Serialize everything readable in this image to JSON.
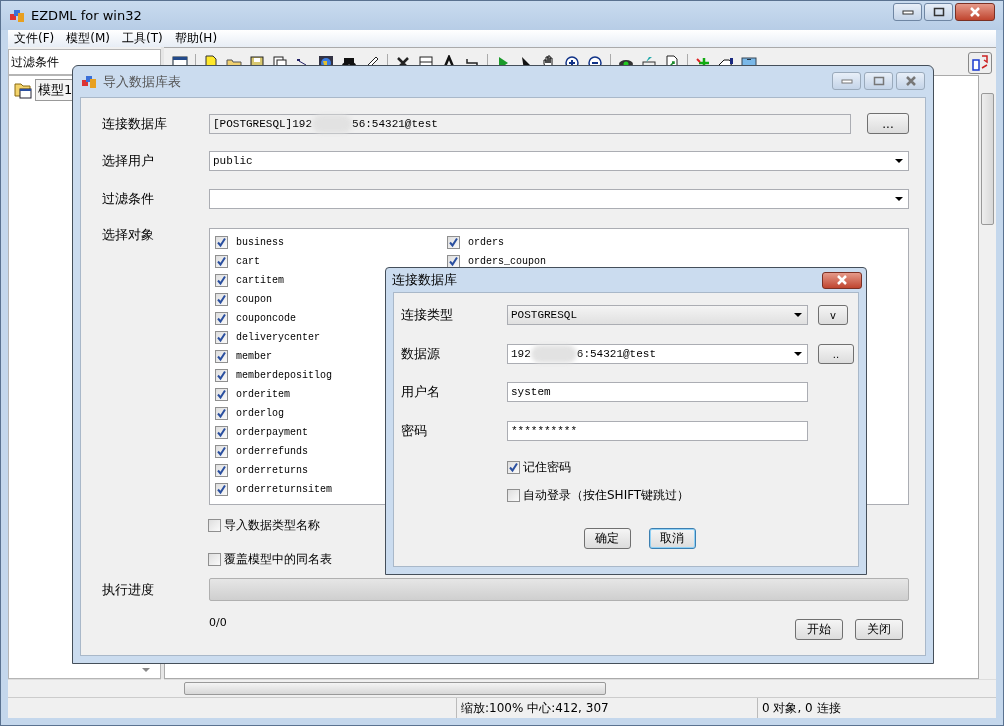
{
  "main_window": {
    "title": "EZDML for win32"
  },
  "menu": [
    {
      "label": "文件(F)"
    },
    {
      "label": "模型(M)"
    },
    {
      "label": "工具(T)"
    },
    {
      "label": "帮助(H)"
    }
  ],
  "left_panel": {
    "filter_label": "过滤条件",
    "tree": [
      {
        "label": "模型1",
        "selected": true
      }
    ]
  },
  "status_bar": {
    "zoom": "缩放:100% 中心:412, 307",
    "counts": "0 对象, 0 连接"
  },
  "import_dialog": {
    "title": "导入数据库表",
    "connection": {
      "label": "连接数据库",
      "value_start": "[POSTGRESQL]192",
      "value_end": "56:54321@test",
      "button": "..."
    },
    "user": {
      "label": "选择用户",
      "value": "public"
    },
    "filter": {
      "label": "过滤条件"
    },
    "objects": {
      "label": "选择对象",
      "columns": [
        [
          {
            "name": "business",
            "checked": true
          },
          {
            "name": "cart",
            "checked": true
          },
          {
            "name": "cartitem",
            "checked": true
          },
          {
            "name": "coupon",
            "checked": true
          },
          {
            "name": "couponcode",
            "checked": true
          },
          {
            "name": "deliverycenter",
            "checked": true
          },
          {
            "name": "member",
            "checked": true
          },
          {
            "name": "memberdepositlog",
            "checked": true
          },
          {
            "name": "orderitem",
            "checked": true
          },
          {
            "name": "orderlog",
            "checked": true
          },
          {
            "name": "orderpayment",
            "checked": true
          },
          {
            "name": "orderrefunds",
            "checked": true
          },
          {
            "name": "orderreturns",
            "checked": true
          },
          {
            "name": "orderreturnsitem",
            "checked": true
          }
        ],
        [
          {
            "name": "orders",
            "checked": true
          },
          {
            "name": "orders_coupon",
            "checked": true
          }
        ]
      ]
    },
    "options": [
      {
        "label": "导入数据类型名称",
        "checked": false
      },
      {
        "label": "覆盖模型中的同名表",
        "checked": false
      }
    ],
    "progress": {
      "label": "执行进度",
      "level": 0,
      "count": "0/0"
    },
    "buttons": [
      "开始",
      "关闭"
    ]
  },
  "connect_dialog": {
    "title": "连接数据库",
    "type": {
      "label": "连接类型",
      "value": "POSTGRESQL",
      "button": "v"
    },
    "source": {
      "label": "数据源",
      "value_start": "192",
      "value_end": "6:54321@test",
      "button": ".."
    },
    "user": {
      "label": "用户名",
      "value": "system"
    },
    "password": {
      "label": "密码",
      "value": "**********"
    },
    "options": [
      {
        "label": "记住密码",
        "checked": true
      },
      {
        "label": "自动登录（按住SHIFT键跳过）",
        "checked": false
      }
    ],
    "buttons": [
      {
        "label": "确定",
        "focused": false
      },
      {
        "label": "取消",
        "focused": true
      }
    ]
  }
}
